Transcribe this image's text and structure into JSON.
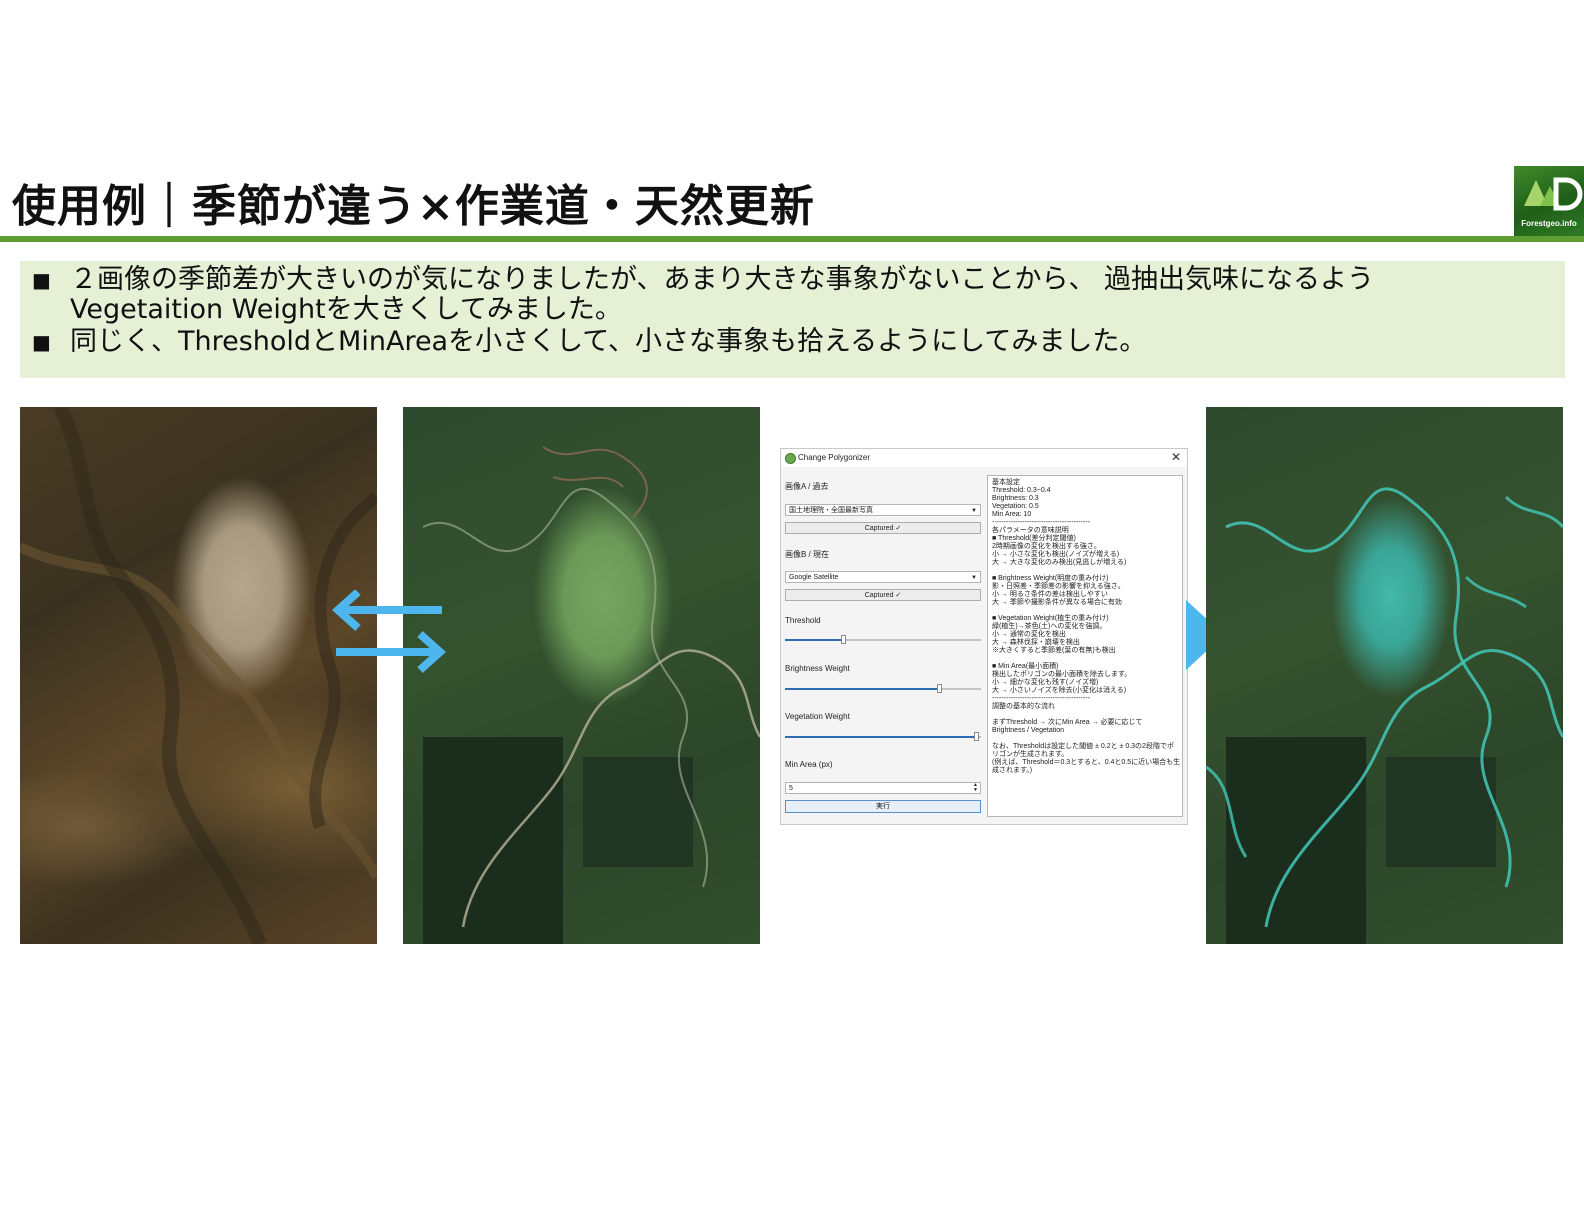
{
  "slide": {
    "title": "使用例｜季節が違う×作業道・天然更新",
    "logo_text": "Forestgeo.info"
  },
  "bullets": [
    {
      "marker": "■",
      "text": "２画像の季節差が大きいのが気になりましたが、あまり大きな事象がないことから、 過抽出気味になるようVegetaition Weightを大きくしてみました。"
    },
    {
      "marker": "■",
      "text": "同じく、ThresholdとMinAreaを小さくして、小さな事象も拾えるようにしてみました。"
    }
  ],
  "colors": {
    "accent_green": "#5e9e32",
    "bullet_bg": "#e5f0d5",
    "arrow_blue": "#4db6ec",
    "detect_cyan": "#43c8b8"
  },
  "dialog": {
    "icon": "qgis-icon",
    "title": "Change Polygonizer",
    "close": "✕",
    "image_a_label": "画像A / 過去",
    "image_a_value": "国土地理院・全国最新写真",
    "image_a_captured": "Captured ✓",
    "image_b_label": "画像B / 現在",
    "image_b_value": "Google Satellite",
    "image_b_captured": "Captured ✓",
    "threshold_label": "Threshold",
    "threshold_level": 0.3,
    "brightness_label": "Brightness Weight",
    "brightness_level": 0.79,
    "vegetation_label": "Vegetation Weight",
    "vegetation_level": 0.98,
    "min_area_label": "Min Area (px)",
    "min_area_value": "5",
    "run_button": "実行",
    "help_lines": [
      "基本設定",
      "Threshold: 0.3~0.4",
      "Brightness: 0.3",
      "Vegetation: 0.5",
      "Min Area: 10",
      "------------------------------------------",
      "各パラメータの意味説明",
      "■ Threshold(差分判定閾値)",
      "2時期画像の変化を検出する強さ。",
      "小 → 小さな変化も検出(ノイズが増える)",
      "大 → 大きな変化のみ検出(見逃しが増える)",
      "",
      "■ Brightness Weight(明度の重み付け)",
      "影・日照差・季節差の影響を抑える強さ。",
      "小 → 明るさ条件の差は検出しやすい",
      "大 → 季節や撮影条件が異なる場合に有効",
      "",
      "■ Vegetation Weight(植生の重み付け)",
      "緑(植生)→茶色(土)への変化を強調。",
      "小 → 通常の変化を検出",
      "大 → 森林伐採・崩壊を検出",
      "※大きくすると季節差(葉の有無)も検出",
      "",
      "■ Min Area(最小面積)",
      "検出したポリゴンの最小面積を除去します。",
      "小 → 細かな変化も残す(ノイズ増)",
      "大 → 小さいノイズを除去(小変化は消える)",
      "------------------------------------------",
      "調整の基本的な流れ",
      "",
      "まずThreshold → 次にMin Area → 必要に応じて",
      "Brightness / Vegetation",
      "",
      "なお、Thresholdは設定した閾値 ± 0.2と ± 0.3の2段階でポ",
      "リゴンが生成されます。",
      "(例えば、Threshold＝0.3とすると、0.4と0.5に近い場合も生",
      "成されます。)"
    ]
  }
}
